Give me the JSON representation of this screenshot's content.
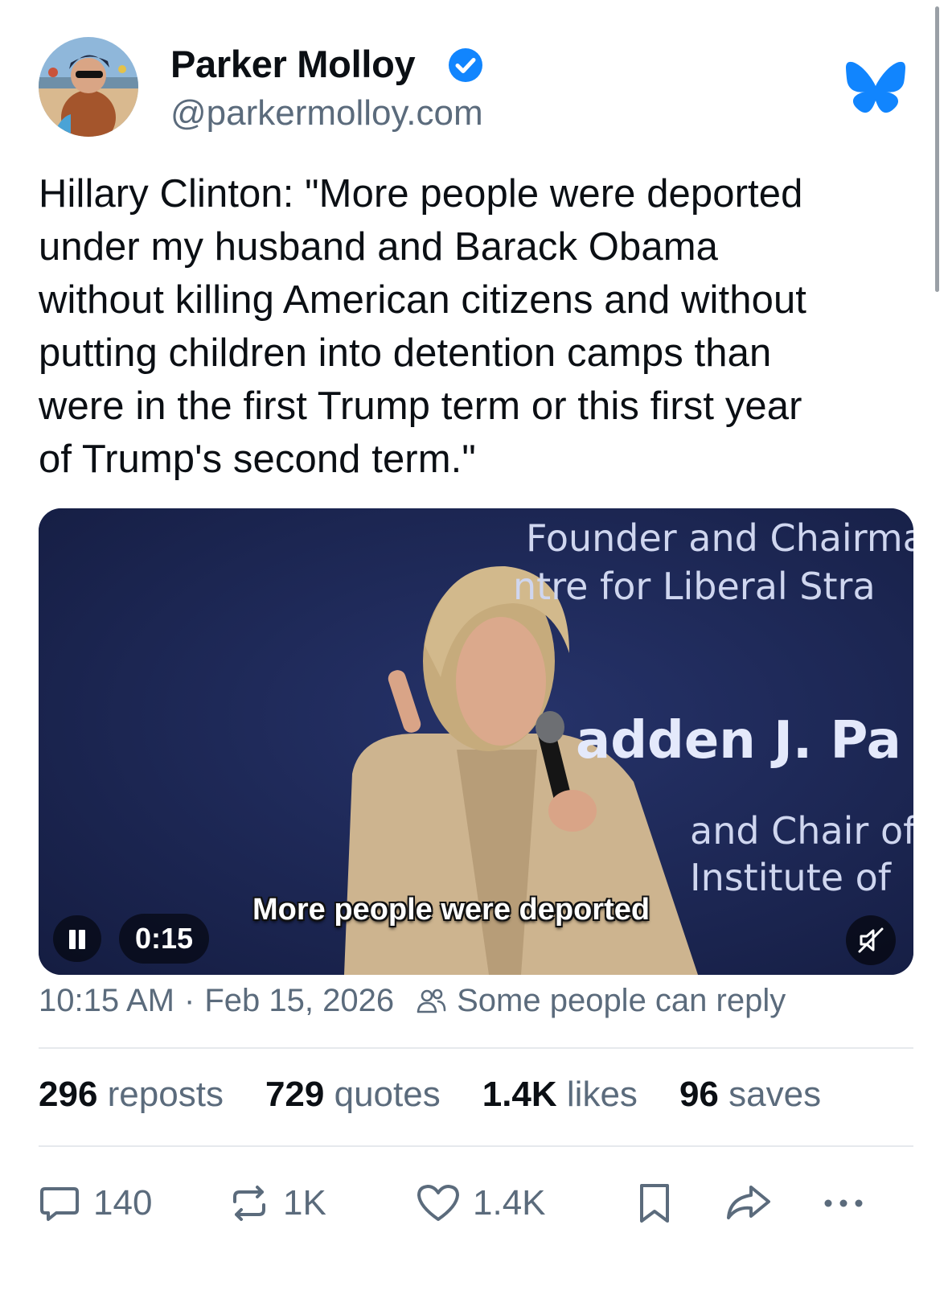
{
  "author": {
    "display_name": "Parker Molloy",
    "handle": "@parkermolloy.com",
    "verified": true
  },
  "post": {
    "text": "Hillary Clinton: \"More people were deported\nunder my husband and Barack Obama\nwithout killing American citizens and without\nputting children into detention camps than\nwere in the first Trump term or this first year\nof Trump's second term.\""
  },
  "video": {
    "overlay_text": [
      "Founder and Chairma",
      "ntre for Liberal Stra",
      "adden J. Pa",
      "and Chair of",
      "Institute of"
    ],
    "caption": "More people were deported",
    "timestamp": "0:15",
    "state": "playing",
    "muted": true
  },
  "meta": {
    "time": "10:15 AM",
    "separator": "·",
    "date": "Feb 15, 2026",
    "reply_setting": "Some people can reply"
  },
  "stats": [
    {
      "count": "296",
      "label": "reposts"
    },
    {
      "count": "729",
      "label": "quotes"
    },
    {
      "count": "1.4K",
      "label": "likes"
    },
    {
      "count": "96",
      "label": "saves"
    }
  ],
  "actions": {
    "reply_count": "140",
    "repost_count": "1K",
    "like_count": "1.4K"
  },
  "colors": {
    "brand_blue": "#1185fe",
    "muted_text": "#5b6b7c",
    "video_backdrop": "#1b2550"
  },
  "icons": [
    "verified-badge-icon",
    "bluesky-butterfly-icon",
    "pause-icon",
    "mute-icon",
    "people-icon",
    "reply-icon",
    "repost-icon",
    "heart-icon",
    "bookmark-icon",
    "share-icon",
    "more-icon"
  ]
}
